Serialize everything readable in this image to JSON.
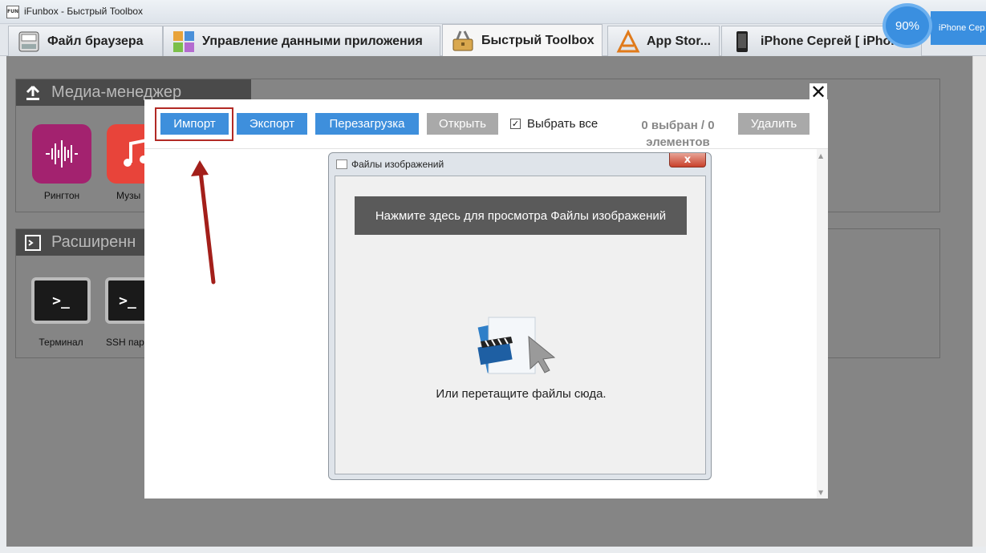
{
  "window": {
    "title": "iFunbox - Быстрый Toolbox",
    "app_icon_text": "FUN"
  },
  "tabs": [
    {
      "label": "Файл браузера",
      "icon": "fun-disk-icon"
    },
    {
      "label": "Управление данными приложения",
      "icon": "app-grid-icon"
    },
    {
      "label": "Быстрый Toolbox",
      "icon": "toolbox-icon",
      "active": true
    },
    {
      "label": "App Stor...",
      "icon": "app-store-icon"
    },
    {
      "label": "iPhone Сергей [ iPhone",
      "icon": "iphone-icon"
    }
  ],
  "badge": {
    "percent": "90%",
    "device": "iPhone Cep"
  },
  "media_section": {
    "title": "Медиа-менеджер",
    "tiles": [
      {
        "label": "Рингтон",
        "icon": "ringtone-icon"
      },
      {
        "label": "Музы",
        "icon": "music-icon"
      }
    ]
  },
  "advanced_section": {
    "title": "Расширенн",
    "tiles": [
      {
        "label": "Терминал",
        "icon": "terminal-icon"
      },
      {
        "label": "SSH пар",
        "icon": "ssh-terminal-icon"
      }
    ]
  },
  "dialog": {
    "buttons": {
      "import": "Импорт",
      "export": "Экспорт",
      "reload": "Перезагрузка",
      "open": "Открыть",
      "delete": "Удалить"
    },
    "select_all": {
      "label": "Выбрать все",
      "checked": true,
      "mark": "✓"
    },
    "selection_count": {
      "line1": "0 выбран / 0",
      "line2": "элементов"
    },
    "close_symbol": "✕"
  },
  "inner_window": {
    "title": "Файлы изображений",
    "close_symbol": "x",
    "browse_button": "Нажмите здесь для просмотра Файлы изображений",
    "drop_hint": "Или перетащите файлы сюда.",
    "illustration": "video-file-drop-icon"
  },
  "colors": {
    "accent_blue": "#3e8fdc",
    "disabled_gray": "#a9a9a9",
    "highlight_red": "#b22a25",
    "arrow_red": "#a31f1a"
  }
}
